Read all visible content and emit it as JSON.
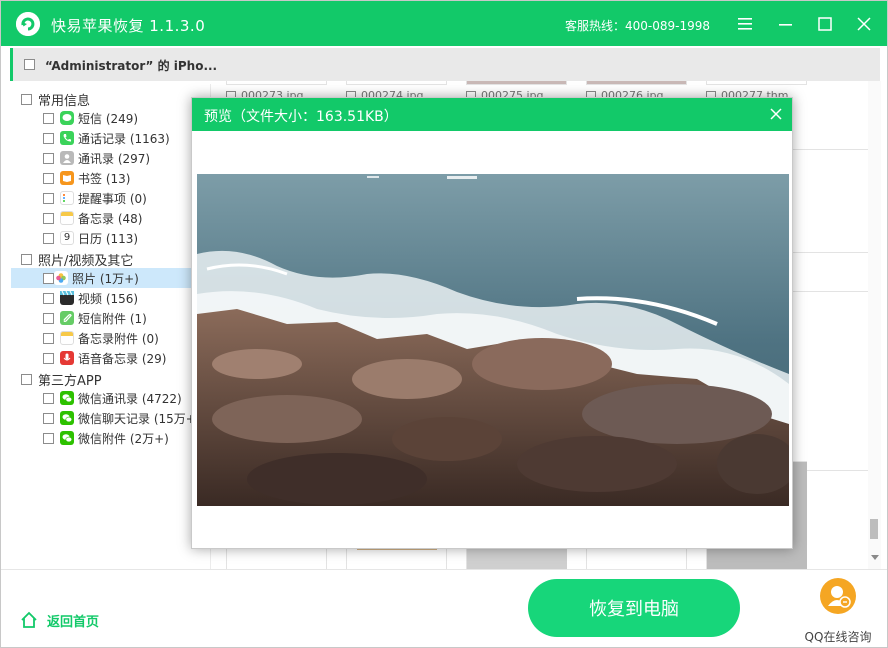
{
  "app": {
    "title": "快易苹果恢复 1.1.3.0",
    "hotline": "客服热线：400-089-1998",
    "accent_color": "#12c969"
  },
  "window_controls": [
    "menu-icon",
    "minimize-icon",
    "maximize-icon",
    "close-icon"
  ],
  "device": {
    "name": "“Administrator” 的 iPho..."
  },
  "sidebar": {
    "categories": [
      {
        "label": "常用信息",
        "items": [
          {
            "label": "短信 (249)",
            "icon": "sms-icon"
          },
          {
            "label": "通话记录 (1163)",
            "icon": "phone-icon"
          },
          {
            "label": "通讯录 (297)",
            "icon": "contacts-icon"
          },
          {
            "label": "书签 (13)",
            "icon": "bookmark-icon"
          },
          {
            "label": "提醒事项 (0)",
            "icon": "reminders-icon"
          },
          {
            "label": "备忘录 (48)",
            "icon": "notes-icon"
          },
          {
            "label": "日历 (113)",
            "icon": "calendar-icon",
            "icon_text": "9"
          }
        ]
      },
      {
        "label": "照片/视频及其它",
        "items": [
          {
            "label": "照片 (1万+)",
            "icon": "photos-icon",
            "selected": true
          },
          {
            "label": "视频 (156)",
            "icon": "video-icon"
          },
          {
            "label": "短信附件 (1)",
            "icon": "attachment-icon"
          },
          {
            "label": "备忘录附件 (0)",
            "icon": "notes-attachment-icon"
          },
          {
            "label": "语音备忘录 (29)",
            "icon": "voice-memo-icon"
          }
        ]
      },
      {
        "label": "第三方APP",
        "items": [
          {
            "label": "微信通讯录 (4722)",
            "icon": "wechat-icon"
          },
          {
            "label": "微信聊天记录 (15万+",
            "icon": "wechat-icon"
          },
          {
            "label": "微信附件 (2万+)",
            "icon": "wechat-icon"
          }
        ]
      }
    ]
  },
  "grid": {
    "files": [
      "000273.jpg",
      "000274.jpg",
      "000275.jpg",
      "000276.jpg",
      "000277.thm"
    ]
  },
  "preview": {
    "title": "预览（文件大小：163.51KB）"
  },
  "footer": {
    "home_label": "返回首页",
    "recover_label": "恢复到电脑",
    "qq_label": "QQ在线咨询"
  }
}
